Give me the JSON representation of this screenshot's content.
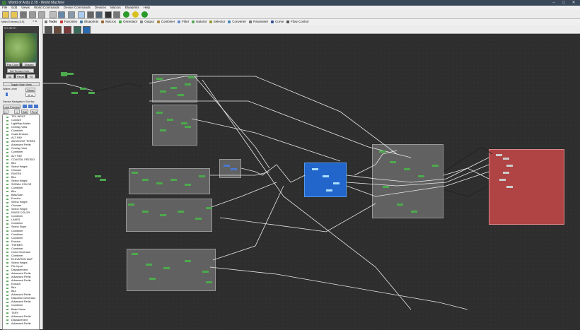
{
  "window": {
    "title": "World of Ardu 2.78 - World Machine"
  },
  "menu": [
    "File",
    "Edit",
    "Views",
    "World Commands",
    "Device Commands",
    "Devices",
    "Macros",
    "Blueprints",
    "Help"
  ],
  "tabs": [
    {
      "label": "Tools",
      "color": "#777777",
      "active": true
    },
    {
      "label": "Favorites",
      "color": "#cc3333"
    },
    {
      "label": "Blueprints",
      "color": "#4477aa"
    },
    {
      "label": "Macros",
      "color": "#996633"
    },
    {
      "label": "Generator",
      "color": "#44aa44"
    },
    {
      "label": "Output",
      "color": "#888888"
    },
    {
      "label": "Combiner",
      "color": "#aa8844"
    },
    {
      "label": "Filter",
      "color": "#6688cc"
    },
    {
      "label": "Natural",
      "color": "#55aa55"
    },
    {
      "label": "Selector",
      "color": "#999933"
    },
    {
      "label": "Converter",
      "color": "#4488bb"
    },
    {
      "label": "Parameter",
      "color": "#777777"
    },
    {
      "label": "Curve",
      "color": "#335599"
    },
    {
      "label": "Flow Control",
      "color": "#555555"
    }
  ],
  "left_panel": {
    "title": "Main Extents (5,5)",
    "preview_label": "TEX INPUT",
    "flat_color": "Flat Color",
    "shaded": "Shaded",
    "set_terrain": "Set Terrain Colo...",
    "btn_3d": "3D",
    "btn_reset": "Reset",
    "btn_fit": "Fit",
    "toggle_main": "Toggle Main View",
    "water_level": "Water Level",
    "show": "Show",
    "water_value": "90 m",
    "device_nav": "Device Navigation",
    "sort_by": "Sort by:",
    "lock_preview": "Lock Preview",
    "nav_first": "|<",
    "nav_prev": "<",
    "nav_edit": "Edit",
    "nav_prev2": "Prev"
  },
  "device_list": [
    "TEX INPUT",
    "Colorize",
    "LightMap Maker",
    "Overlay View",
    "Combiner",
    "Coast Erosion",
    "ALT FillV",
    "ADJACENT TERRA",
    "Advanced Perlin",
    "Overlay View",
    "Combiner",
    "ALT FillV",
    "COASTAL EROSIO",
    "Blur",
    "Select Height",
    "Chooser",
    "RIVERS",
    "Blur",
    "Select Height",
    "SIGNAL COLOR",
    "Combiner",
    "Blur",
    "Bias/Gain",
    "Erosion",
    "Select Height",
    "Chooser",
    "Select Height",
    "RIVER COLOR",
    "Combiner",
    "LAKES",
    "Combiner",
    "Select Slope",
    "Combiner",
    "Combiner",
    "Combiner",
    "Erosion",
    "THEMES",
    "Combiner",
    "Color Generator",
    "Combiner",
    "ELEVATION MAP",
    "Select Height",
    "File Input",
    "Displacement",
    "Advanced Perlin",
    "Advanced Perlin",
    "Advanced Perlin",
    "Erosion",
    "Blur",
    "Blur",
    "Advanced Perlin",
    "Distortion Generator",
    "Advanced Perlin",
    "Combiner",
    "Basic Noise",
    "TERY",
    "Advanced Perlin",
    "Displacement",
    "Advanced Perlin"
  ]
}
